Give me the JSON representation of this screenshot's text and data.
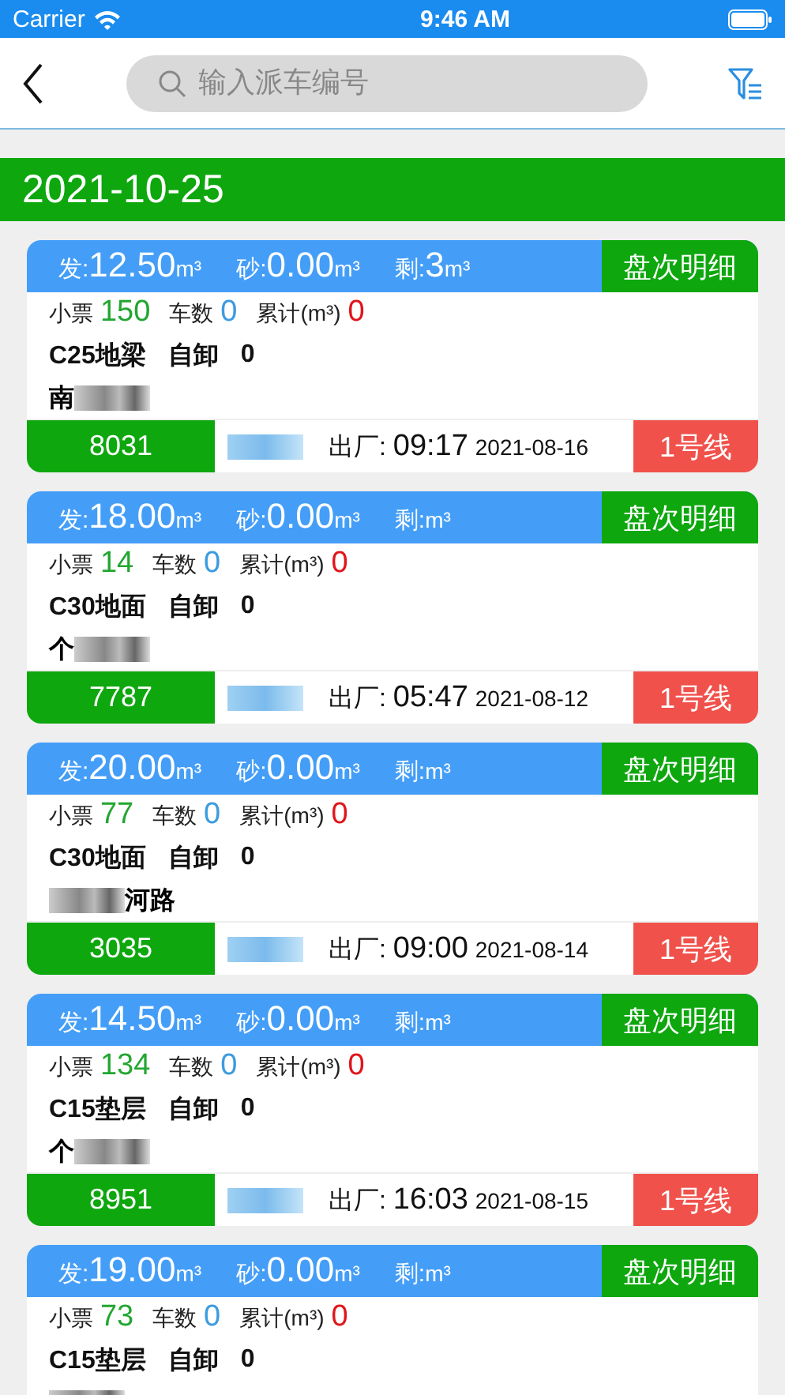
{
  "status_bar": {
    "carrier": "Carrier",
    "time": "9:46 AM"
  },
  "search": {
    "placeholder": "输入派车编号"
  },
  "date": "2021-10-25",
  "cards": [
    {
      "stats": [
        {
          "label": "发:",
          "value": "12.50",
          "unit": "m³"
        },
        {
          "label": "砂:",
          "value": "0.00",
          "unit": "m³"
        },
        {
          "label": "剩:",
          "value": "3",
          "unit": "m³"
        }
      ],
      "detail_button": "盘次明细",
      "counts": [
        {
          "label": "小票",
          "value": "150",
          "color": "#22a630"
        },
        {
          "label": "车数",
          "value": "0",
          "color": "#3d9be0"
        },
        {
          "label": "累计(m³)",
          "value": "0",
          "color": "#e0161b"
        }
      ],
      "product": "C25地梁",
      "method": "自卸",
      "method_value": "0",
      "address": {
        "text": "南",
        "blurred_before": false,
        "blurred_after": true
      },
      "footer": {
        "vehicle": "8031",
        "depart_label": "出厂:",
        "depart_time": "09:17",
        "depart_date": "2021-08-16",
        "line": "1号线"
      }
    },
    {
      "stats": [
        {
          "label": "发:",
          "value": "18.00",
          "unit": "m³"
        },
        {
          "label": "砂:",
          "value": "0.00",
          "unit": "m³"
        },
        {
          "label": "剩:",
          "unit": "m³"
        }
      ],
      "detail_button": "盘次明细",
      "counts": [
        {
          "label": "小票",
          "value": "14",
          "color": "#22a630"
        },
        {
          "label": "车数",
          "value": "0",
          "color": "#3d9be0"
        },
        {
          "label": "累计(m³)",
          "value": "0",
          "color": "#e0161b"
        }
      ],
      "product": "C30地面",
      "method": "自卸",
      "method_value": "0",
      "address": {
        "text": "个",
        "blurred_before": false,
        "blurred_after": true
      },
      "footer": {
        "vehicle": "7787",
        "depart_label": "出厂:",
        "depart_time": "05:47",
        "depart_date": "2021-08-12",
        "line": "1号线"
      }
    },
    {
      "stats": [
        {
          "label": "发:",
          "value": "20.00",
          "unit": "m³"
        },
        {
          "label": "砂:",
          "value": "0.00",
          "unit": "m³"
        },
        {
          "label": "剩:",
          "unit": "m³"
        }
      ],
      "detail_button": "盘次明细",
      "counts": [
        {
          "label": "小票",
          "value": "77",
          "color": "#22a630"
        },
        {
          "label": "车数",
          "value": "0",
          "color": "#3d9be0"
        },
        {
          "label": "累计(m³)",
          "value": "0",
          "color": "#e0161b"
        }
      ],
      "product": "C30地面",
      "method": "自卸",
      "method_value": "0",
      "address": {
        "text": "河路",
        "blurred_before": true,
        "blurred_after": false
      },
      "footer": {
        "vehicle": "3035",
        "depart_label": "出厂:",
        "depart_time": "09:00",
        "depart_date": "2021-08-14",
        "line": "1号线"
      }
    },
    {
      "stats": [
        {
          "label": "发:",
          "value": "14.50",
          "unit": "m³"
        },
        {
          "label": "砂:",
          "value": "0.00",
          "unit": "m³"
        },
        {
          "label": "剩:",
          "unit": "m³"
        }
      ],
      "detail_button": "盘次明细",
      "counts": [
        {
          "label": "小票",
          "value": "134",
          "color": "#22a630"
        },
        {
          "label": "车数",
          "value": "0",
          "color": "#3d9be0"
        },
        {
          "label": "累计(m³)",
          "value": "0",
          "color": "#e0161b"
        }
      ],
      "product": "C15垫层",
      "method": "自卸",
      "method_value": "0",
      "address": {
        "text": "个",
        "blurred_before": false,
        "blurred_after": true
      },
      "footer": {
        "vehicle": "8951",
        "depart_label": "出厂:",
        "depart_time": "16:03",
        "depart_date": "2021-08-15",
        "line": "1号线"
      }
    },
    {
      "stats": [
        {
          "label": "发:",
          "value": "19.00",
          "unit": "m³"
        },
        {
          "label": "砂:",
          "value": "0.00",
          "unit": "m³"
        },
        {
          "label": "剩:",
          "unit": "m³"
        }
      ],
      "detail_button": "盘次明细",
      "counts": [
        {
          "label": "小票",
          "value": "73",
          "color": "#22a630"
        },
        {
          "label": "车数",
          "value": "0",
          "color": "#3d9be0"
        },
        {
          "label": "累计(m³)",
          "value": "0",
          "color": "#e0161b"
        }
      ],
      "product": "C15垫层",
      "method": "自卸",
      "method_value": "0",
      "address": {
        "blurred_before": true,
        "blurred_after": false
      }
    }
  ]
}
